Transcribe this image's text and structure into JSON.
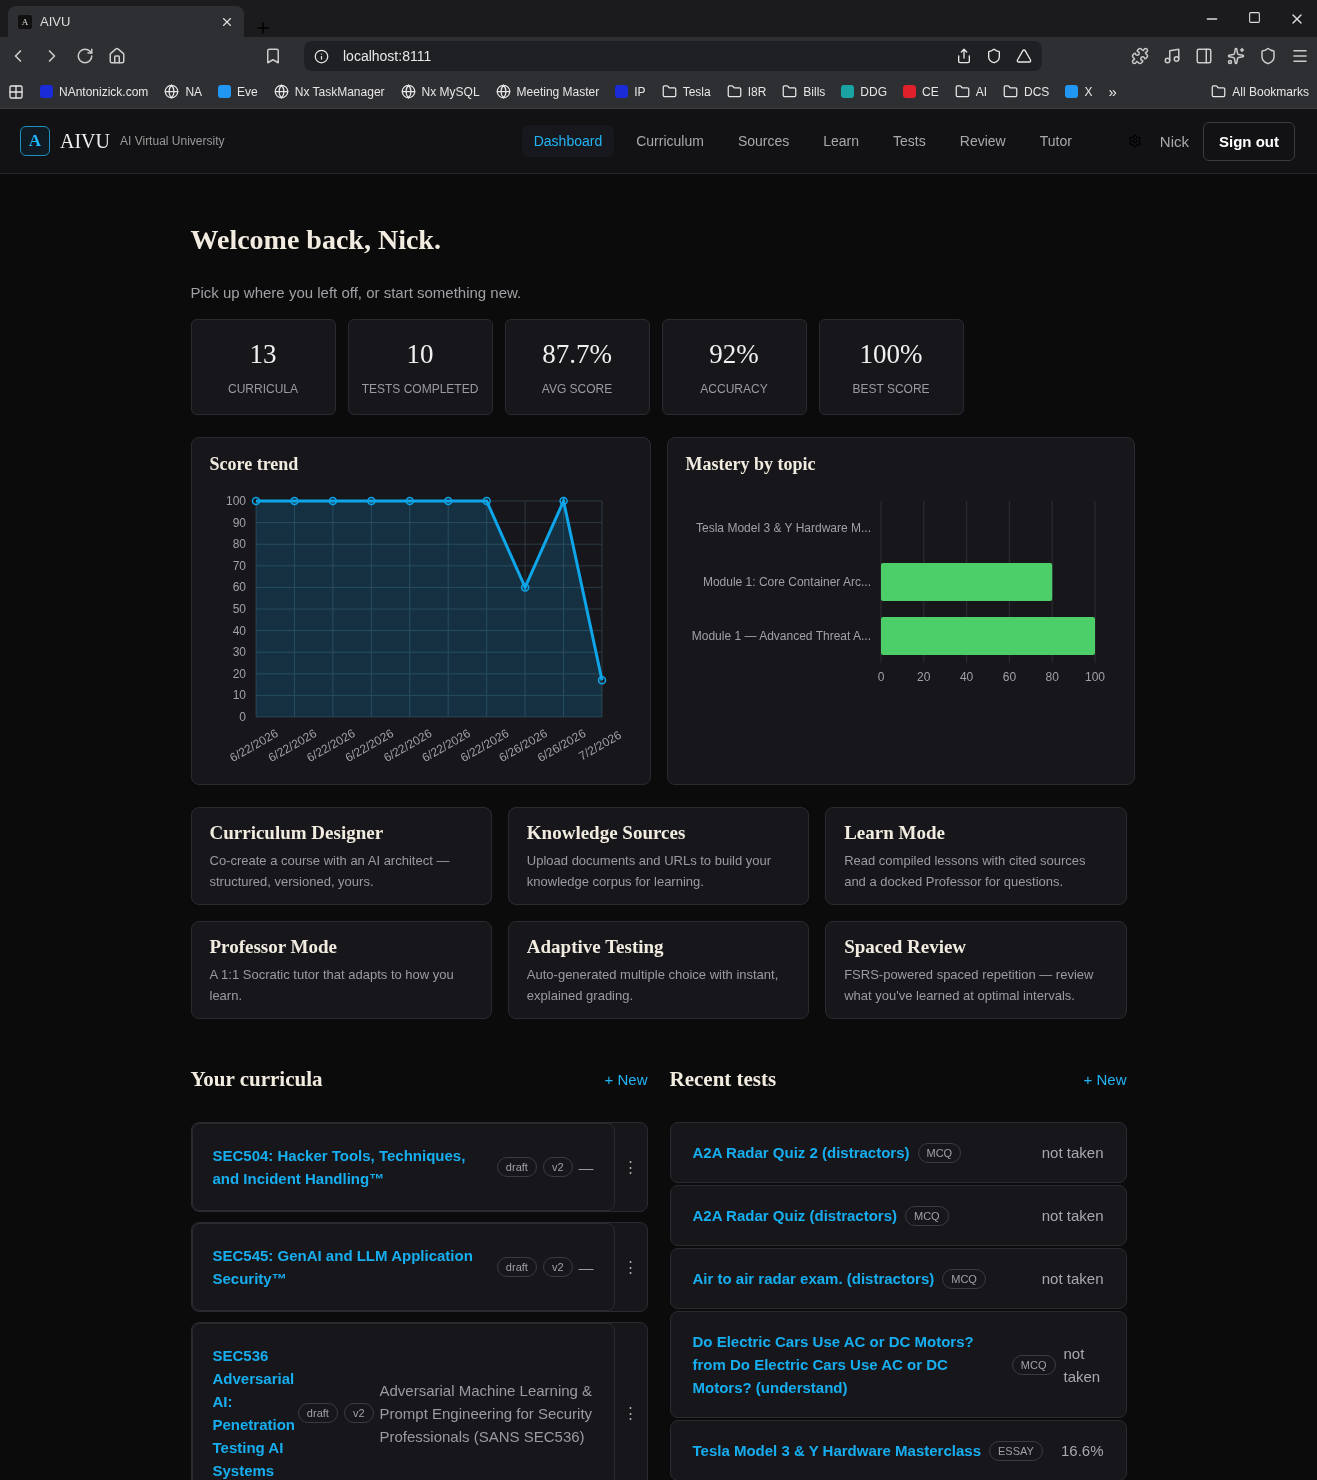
{
  "browser": {
    "tab_title": "AIVU",
    "tab_favicon": "A",
    "url": "localhost:8111",
    "bookmarks": [
      {
        "label": "NAntonizick.com",
        "kind": "site"
      },
      {
        "label": "NA",
        "kind": "globe"
      },
      {
        "label": "Eve",
        "kind": "site"
      },
      {
        "label": "Nx TaskManager",
        "kind": "globe"
      },
      {
        "label": "Nx MySQL",
        "kind": "globe"
      },
      {
        "label": "Meeting Master",
        "kind": "globe"
      },
      {
        "label": "IP",
        "kind": "site"
      },
      {
        "label": "Tesla",
        "kind": "folder"
      },
      {
        "label": "I8R",
        "kind": "folder"
      },
      {
        "label": "Bills",
        "kind": "folder"
      },
      {
        "label": "DDG",
        "kind": "site"
      },
      {
        "label": "CE",
        "kind": "site"
      },
      {
        "label": "AI",
        "kind": "folder"
      },
      {
        "label": "DCS",
        "kind": "folder"
      },
      {
        "label": "X",
        "kind": "site"
      }
    ],
    "overflow": "»",
    "all_bookmarks": "All Bookmarks"
  },
  "header": {
    "logo_letter": "A",
    "name": "AIVU",
    "tagline": "AI Virtual University",
    "nav": [
      {
        "label": "Dashboard",
        "selected": true
      },
      {
        "label": "Curriculum",
        "selected": false
      },
      {
        "label": "Sources",
        "selected": false
      },
      {
        "label": "Learn",
        "selected": false
      },
      {
        "label": "Tests",
        "selected": false
      },
      {
        "label": "Review",
        "selected": false
      },
      {
        "label": "Tutor",
        "selected": false
      }
    ],
    "user": "Nick",
    "sign_out": "Sign out"
  },
  "welcome": {
    "title": "Welcome back, Nick.",
    "subtitle": "Pick up where you left off, or start something new."
  },
  "stats": [
    {
      "value": "13",
      "label": "CURRICULA"
    },
    {
      "value": "10",
      "label": "TESTS COMPLETED"
    },
    {
      "value": "87.7%",
      "label": "AVG SCORE"
    },
    {
      "value": "92%",
      "label": "ACCURACY"
    },
    {
      "value": "100%",
      "label": "BEST SCORE"
    }
  ],
  "score_trend": {
    "title": "Score trend",
    "chart_data": {
      "type": "area",
      "categories": [
        "6/22/2026",
        "6/22/2026",
        "6/22/2026",
        "6/22/2026",
        "6/22/2026",
        "6/22/2026",
        "6/22/2026",
        "6/26/2026",
        "6/26/2026",
        "7/2/2026"
      ],
      "series": [
        {
          "color": "#0ea5e9",
          "values": [
            100,
            100,
            100,
            100,
            100,
            100,
            100,
            60,
            100,
            17
          ]
        }
      ],
      "grid": true,
      "ylim": [
        0,
        100
      ],
      "yticks": [
        0,
        10,
        20,
        30,
        40,
        50,
        60,
        70,
        80,
        90,
        100
      ]
    }
  },
  "mastery": {
    "title": "Mastery by topic",
    "chart_data": {
      "type": "bar",
      "orientation": "horizontal",
      "categories": [
        "Tesla Model 3 & Y Hardware M...",
        "Module 1: Core Container Arc...",
        "Module 1 — Advanced Threat A..."
      ],
      "series": [
        {
          "color": "#4ccf68",
          "values": [
            0,
            80,
            100
          ]
        }
      ],
      "grid": true,
      "xlim": [
        0,
        100
      ],
      "xticks": [
        0,
        20,
        40,
        60,
        80,
        100
      ]
    }
  },
  "features": [
    {
      "title": "Curriculum Designer",
      "text": "Co-create a course with an AI architect — structured, versioned, yours."
    },
    {
      "title": "Knowledge Sources",
      "text": "Upload documents and URLs to build your knowledge corpus for learning."
    },
    {
      "title": "Learn Mode",
      "text": "Read compiled lessons with cited sources and a docked Professor for questions."
    },
    {
      "title": "Professor Mode",
      "text": "A 1:1 Socratic tutor that adapts to how you learn."
    },
    {
      "title": "Adaptive Testing",
      "text": "Auto-generated multiple choice with instant, explained grading."
    },
    {
      "title": "Spaced Review",
      "text": "FSRS-powered spaced repetition — review what you've learned at optimal intervals."
    }
  ],
  "curricula": {
    "title": "Your curricula",
    "new": "+ New",
    "items": [
      {
        "title": "SEC504: Hacker Tools, Techniques, and Incident Handling™",
        "status": "draft",
        "version": "v2",
        "description": "—",
        "menu": "⋮"
      },
      {
        "title": "SEC545: GenAI and LLM Application Security™",
        "status": "draft",
        "version": "v2",
        "description": "—",
        "menu": "⋮"
      },
      {
        "title": "SEC536 Adversarial AI: Penetration Testing AI Systems",
        "status": "draft",
        "version": "v2",
        "description": "Adversarial Machine Learning & Prompt Engineering for Security Professionals (SANS SEC536)",
        "menu": "⋮"
      }
    ]
  },
  "tests": {
    "title": "Recent tests",
    "new": "+ New",
    "items": [
      {
        "title": "A2A Radar Quiz 2 (distractors)",
        "type": "MCQ",
        "result": "not taken"
      },
      {
        "title": "A2A Radar Quiz (distractors)",
        "type": "MCQ",
        "result": "not taken"
      },
      {
        "title": "Air to air radar exam. (distractors)",
        "type": "MCQ",
        "result": "not taken"
      },
      {
        "title": "Do Electric Cars Use AC or DC Motors? from Do Electric Cars Use AC or DC Motors? (understand)",
        "type": "MCQ",
        "result": "not taken"
      },
      {
        "title": "Tesla Model 3 & Y Hardware Masterclass",
        "type": "ESSAY",
        "result": "16.6%"
      }
    ]
  }
}
